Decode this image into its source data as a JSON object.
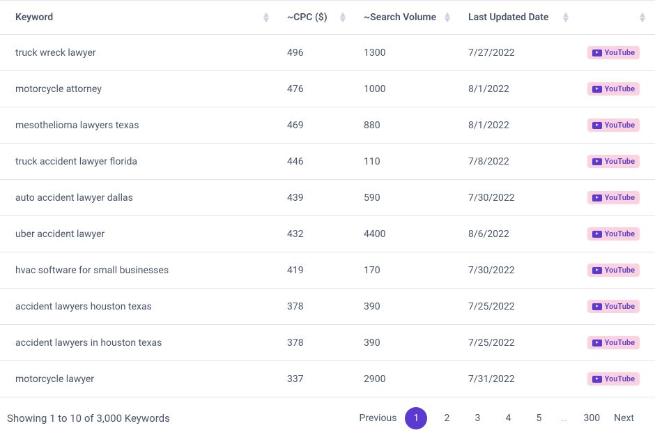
{
  "table": {
    "headers": {
      "keyword": "Keyword",
      "cpc": "~CPC ($)",
      "volume": "~Search Volume",
      "date": "Last Updated Date",
      "action": ""
    },
    "youtube_label": "YouTube",
    "rows": [
      {
        "keyword": "truck wreck lawyer",
        "cpc": "496",
        "volume": "1300",
        "date": "7/27/2022"
      },
      {
        "keyword": "motorcycle attorney",
        "cpc": "476",
        "volume": "1000",
        "date": "8/1/2022"
      },
      {
        "keyword": "mesothelioma lawyers texas",
        "cpc": "469",
        "volume": "880",
        "date": "8/1/2022"
      },
      {
        "keyword": "truck accident lawyer florida",
        "cpc": "446",
        "volume": "110",
        "date": "7/8/2022"
      },
      {
        "keyword": "auto accident lawyer dallas",
        "cpc": "439",
        "volume": "590",
        "date": "7/30/2022"
      },
      {
        "keyword": "uber accident lawyer",
        "cpc": "432",
        "volume": "4400",
        "date": "8/6/2022"
      },
      {
        "keyword": "hvac software for small businesses",
        "cpc": "419",
        "volume": "170",
        "date": "7/30/2022"
      },
      {
        "keyword": "accident lawyers houston texas",
        "cpc": "378",
        "volume": "390",
        "date": "7/25/2022"
      },
      {
        "keyword": "accident lawyers in houston texas",
        "cpc": "378",
        "volume": "390",
        "date": "7/25/2022"
      },
      {
        "keyword": "motorcycle lawyer",
        "cpc": "337",
        "volume": "2900",
        "date": "7/31/2022"
      }
    ]
  },
  "footer": {
    "status": "Showing 1 to 10 of 3,000 Keywords",
    "pagination": {
      "previous": "Previous",
      "next": "Next",
      "pages": [
        "1",
        "2",
        "3",
        "4",
        "5"
      ],
      "ellipsis": "…",
      "last": "300",
      "active": "1"
    }
  }
}
